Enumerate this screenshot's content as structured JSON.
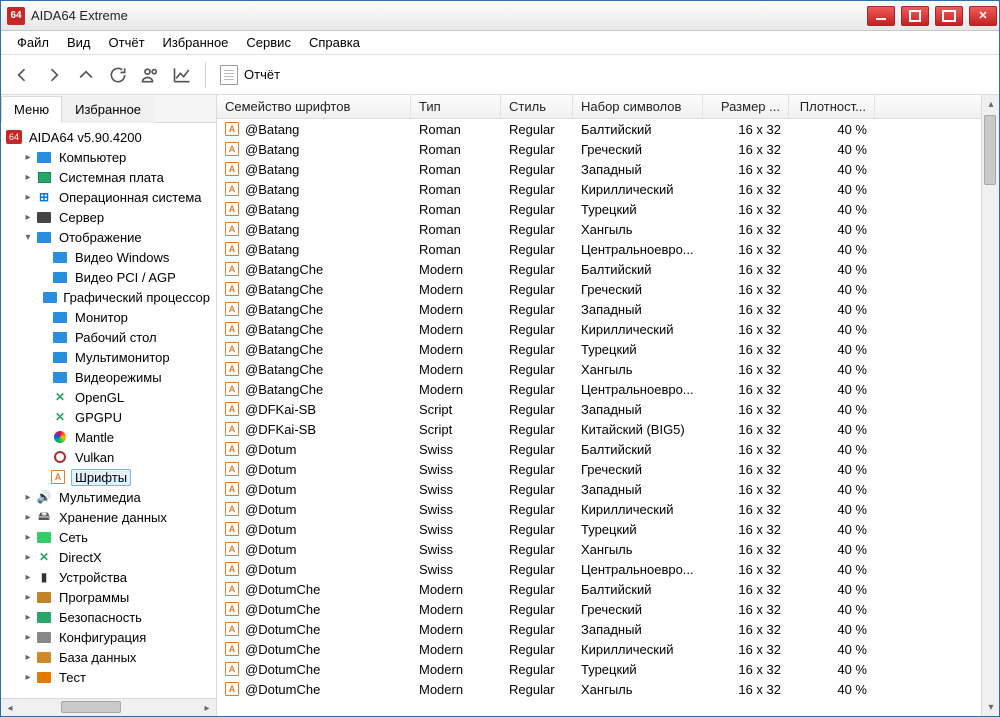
{
  "titlebar": {
    "title": "AIDA64 Extreme",
    "app_icon_text": "64"
  },
  "menu": {
    "file": "Файл",
    "view": "Вид",
    "report": "Отчёт",
    "favorites": "Избранное",
    "service": "Сервис",
    "help": "Справка"
  },
  "toolbar": {
    "report_label": "Отчёт"
  },
  "tabs": {
    "menu": "Меню",
    "favorites": "Избранное"
  },
  "tree": {
    "root": "AIDA64 v5.90.4200",
    "items": [
      {
        "l": "Компьютер",
        "d": 1,
        "ic": "mon",
        "tw": "▸"
      },
      {
        "l": "Системная плата",
        "d": 1,
        "ic": "chip",
        "tw": "▸"
      },
      {
        "l": "Операционная система",
        "d": 1,
        "ic": "win",
        "tw": "▸"
      },
      {
        "l": "Сервер",
        "d": 1,
        "ic": "srv",
        "tw": "▸"
      },
      {
        "l": "Отображение",
        "d": 1,
        "ic": "mon",
        "tw": "▾",
        "exp": true
      },
      {
        "l": "Видео Windows",
        "d": 2,
        "ic": "mon"
      },
      {
        "l": "Видео PCI / AGP",
        "d": 2,
        "ic": "mon"
      },
      {
        "l": "Графический процессор",
        "d": 2,
        "ic": "mon"
      },
      {
        "l": "Монитор",
        "d": 2,
        "ic": "mon"
      },
      {
        "l": "Рабочий стол",
        "d": 2,
        "ic": "mon"
      },
      {
        "l": "Мультимонитор",
        "d": 2,
        "ic": "mon"
      },
      {
        "l": "Видеорежимы",
        "d": 2,
        "ic": "mon"
      },
      {
        "l": "OpenGL",
        "d": 2,
        "ic": "gl"
      },
      {
        "l": "GPGPU",
        "d": 2,
        "ic": "gl"
      },
      {
        "l": "Mantle",
        "d": 2,
        "ic": "mantle"
      },
      {
        "l": "Vulkan",
        "d": 2,
        "ic": "vk"
      },
      {
        "l": "Шрифты",
        "d": 2,
        "ic": "font",
        "sel": true
      },
      {
        "l": "Мультимедиа",
        "d": 1,
        "ic": "mm",
        "tw": "▸"
      },
      {
        "l": "Хранение данных",
        "d": 1,
        "ic": "hdd",
        "tw": "▸"
      },
      {
        "l": "Сеть",
        "d": 1,
        "ic": "net",
        "tw": "▸"
      },
      {
        "l": "DirectX",
        "d": 1,
        "ic": "dx",
        "tw": "▸"
      },
      {
        "l": "Устройства",
        "d": 1,
        "ic": "dev",
        "tw": "▸"
      },
      {
        "l": "Программы",
        "d": 1,
        "ic": "prog",
        "tw": "▸"
      },
      {
        "l": "Безопасность",
        "d": 1,
        "ic": "sec",
        "tw": "▸"
      },
      {
        "l": "Конфигурация",
        "d": 1,
        "ic": "cfg",
        "tw": "▸"
      },
      {
        "l": "База данных",
        "d": 1,
        "ic": "db",
        "tw": "▸"
      },
      {
        "l": "Тест",
        "d": 1,
        "ic": "test",
        "tw": "▸"
      }
    ]
  },
  "grid": {
    "headers": [
      "Семейство шрифтов",
      "Тип",
      "Стиль",
      "Набор символов",
      "Размер ...",
      "Плотност..."
    ],
    "rows": [
      [
        "@Batang",
        "Roman",
        "Regular",
        "Балтийский",
        "16 x 32",
        "40 %"
      ],
      [
        "@Batang",
        "Roman",
        "Regular",
        "Греческий",
        "16 x 32",
        "40 %"
      ],
      [
        "@Batang",
        "Roman",
        "Regular",
        "Западный",
        "16 x 32",
        "40 %"
      ],
      [
        "@Batang",
        "Roman",
        "Regular",
        "Кириллический",
        "16 x 32",
        "40 %"
      ],
      [
        "@Batang",
        "Roman",
        "Regular",
        "Турецкий",
        "16 x 32",
        "40 %"
      ],
      [
        "@Batang",
        "Roman",
        "Regular",
        "Хангыль",
        "16 x 32",
        "40 %"
      ],
      [
        "@Batang",
        "Roman",
        "Regular",
        "Центральноевро...",
        "16 x 32",
        "40 %"
      ],
      [
        "@BatangChe",
        "Modern",
        "Regular",
        "Балтийский",
        "16 x 32",
        "40 %"
      ],
      [
        "@BatangChe",
        "Modern",
        "Regular",
        "Греческий",
        "16 x 32",
        "40 %"
      ],
      [
        "@BatangChe",
        "Modern",
        "Regular",
        "Западный",
        "16 x 32",
        "40 %"
      ],
      [
        "@BatangChe",
        "Modern",
        "Regular",
        "Кириллический",
        "16 x 32",
        "40 %"
      ],
      [
        "@BatangChe",
        "Modern",
        "Regular",
        "Турецкий",
        "16 x 32",
        "40 %"
      ],
      [
        "@BatangChe",
        "Modern",
        "Regular",
        "Хангыль",
        "16 x 32",
        "40 %"
      ],
      [
        "@BatangChe",
        "Modern",
        "Regular",
        "Центральноевро...",
        "16 x 32",
        "40 %"
      ],
      [
        "@DFKai-SB",
        "Script",
        "Regular",
        "Западный",
        "16 x 32",
        "40 %"
      ],
      [
        "@DFKai-SB",
        "Script",
        "Regular",
        "Китайский (BIG5)",
        "16 x 32",
        "40 %"
      ],
      [
        "@Dotum",
        "Swiss",
        "Regular",
        "Балтийский",
        "16 x 32",
        "40 %"
      ],
      [
        "@Dotum",
        "Swiss",
        "Regular",
        "Греческий",
        "16 x 32",
        "40 %"
      ],
      [
        "@Dotum",
        "Swiss",
        "Regular",
        "Западный",
        "16 x 32",
        "40 %"
      ],
      [
        "@Dotum",
        "Swiss",
        "Regular",
        "Кириллический",
        "16 x 32",
        "40 %"
      ],
      [
        "@Dotum",
        "Swiss",
        "Regular",
        "Турецкий",
        "16 x 32",
        "40 %"
      ],
      [
        "@Dotum",
        "Swiss",
        "Regular",
        "Хангыль",
        "16 x 32",
        "40 %"
      ],
      [
        "@Dotum",
        "Swiss",
        "Regular",
        "Центральноевро...",
        "16 x 32",
        "40 %"
      ],
      [
        "@DotumChe",
        "Modern",
        "Regular",
        "Балтийский",
        "16 x 32",
        "40 %"
      ],
      [
        "@DotumChe",
        "Modern",
        "Regular",
        "Греческий",
        "16 x 32",
        "40 %"
      ],
      [
        "@DotumChe",
        "Modern",
        "Regular",
        "Западный",
        "16 x 32",
        "40 %"
      ],
      [
        "@DotumChe",
        "Modern",
        "Regular",
        "Кириллический",
        "16 x 32",
        "40 %"
      ],
      [
        "@DotumChe",
        "Modern",
        "Regular",
        "Турецкий",
        "16 x 32",
        "40 %"
      ],
      [
        "@DotumChe",
        "Modern",
        "Regular",
        "Хангыль",
        "16 x 32",
        "40 %"
      ]
    ]
  }
}
